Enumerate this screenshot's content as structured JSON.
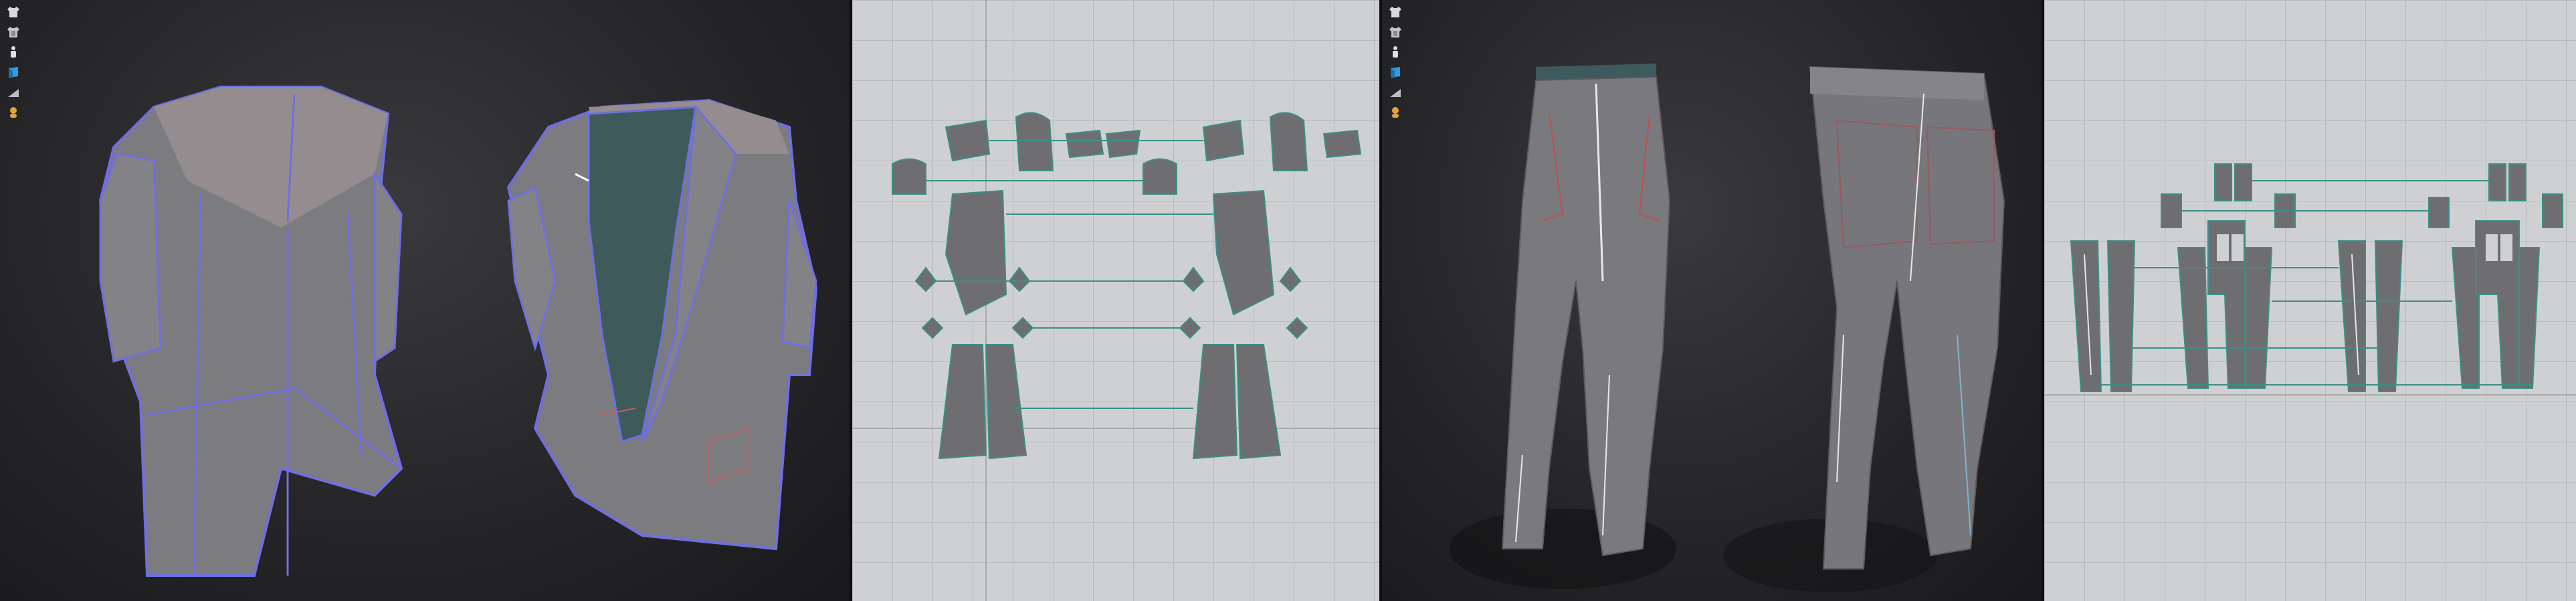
{
  "viewports": [
    {
      "name": "3d-viewport-jacket",
      "mode": "3D"
    },
    {
      "name": "2d-pattern-jacket",
      "mode": "2D"
    },
    {
      "name": "3d-viewport-pants",
      "mode": "3D"
    },
    {
      "name": "2d-pattern-pants",
      "mode": "2D"
    }
  ],
  "toolbar": {
    "tools": [
      {
        "icon": "garment-icon"
      },
      {
        "icon": "garment-layer-icon"
      },
      {
        "icon": "avatar-icon"
      },
      {
        "icon": "fabric-icon"
      },
      {
        "icon": "measure-icon"
      },
      {
        "icon": "avatar-head-icon"
      }
    ]
  },
  "colors": {
    "viewport_bg": "#262629",
    "pattern_bg": "#cfd0d2",
    "garment": "#7c7b7f",
    "seam": "#6f6fe0",
    "lining": "#3f5a5b",
    "pattern_piece": "#6e6e71"
  }
}
